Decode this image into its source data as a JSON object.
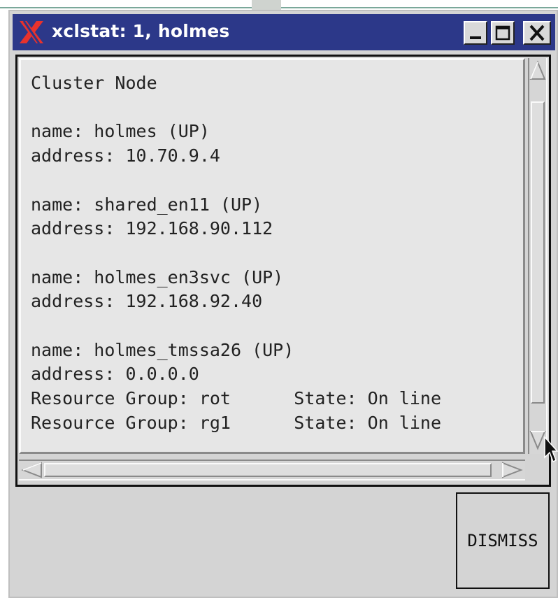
{
  "window": {
    "title": "xclstat: 1, holmes",
    "controls": [
      "minimize-icon",
      "maximize-icon",
      "close-icon"
    ]
  },
  "content": {
    "lines": [
      "Cluster Node",
      "",
      "name: holmes (UP)",
      "address: 10.70.9.4",
      "",
      "name: shared_en11 (UP)",
      "address: 192.168.90.112",
      "",
      "name: holmes_en3svc (UP)",
      "address: 192.168.92.40",
      "",
      "name: holmes_tmssa26 (UP)",
      "address: 0.0.0.0",
      "Resource Group: rot      State: On line",
      "Resource Group: rg1      State: On line"
    ]
  },
  "buttons": {
    "dismiss_label": "DISMISS"
  },
  "colors": {
    "titlebar": "#2c3889",
    "logo": "#e8322c",
    "window_bg": "#d4d4d4",
    "text_area_bg": "#e6e6e6"
  }
}
